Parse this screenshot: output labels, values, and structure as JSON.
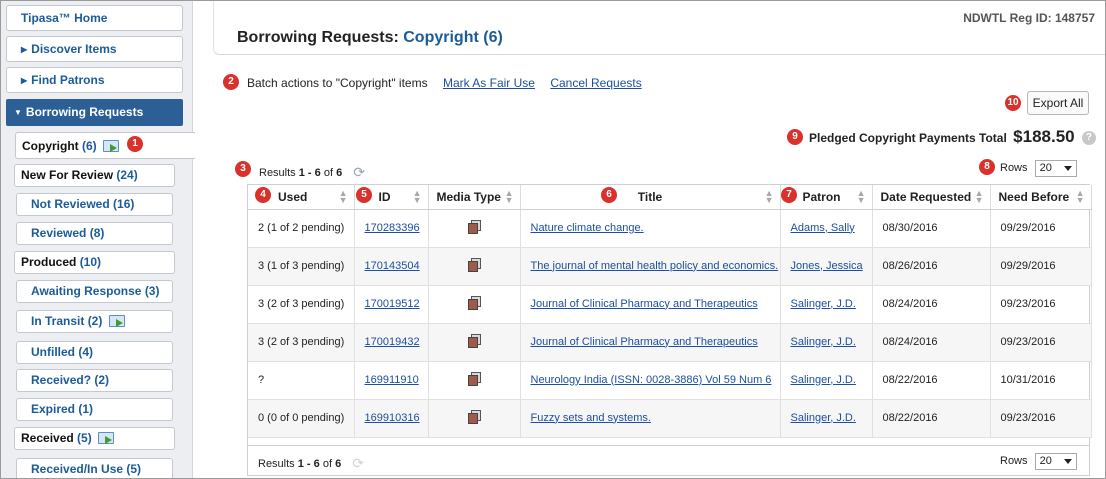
{
  "sidebar": {
    "home": "Tipasa™ Home",
    "discover": "Discover Items",
    "find_patrons": "Find Patrons",
    "section": "Borrowing Requests",
    "items": [
      {
        "label": "Copyright",
        "count": "(6)"
      },
      {
        "label": "New For Review",
        "count": "(24)"
      },
      {
        "label": "Not Reviewed",
        "count": "(16)"
      },
      {
        "label": "Reviewed",
        "count": "(8)"
      },
      {
        "label": "Produced",
        "count": "(10)"
      },
      {
        "label": "Awaiting Response",
        "count": "(3)"
      },
      {
        "label": "In Transit",
        "count": "(2)"
      },
      {
        "label": "Unfilled",
        "count": "(4)"
      },
      {
        "label": "Received?",
        "count": "(2)"
      },
      {
        "label": "Expired",
        "count": "(1)"
      },
      {
        "label": "Received",
        "count": "(5)"
      },
      {
        "label": "Received/In Use",
        "count": "(5)"
      }
    ]
  },
  "header": {
    "title": "Borrowing Requests:",
    "title_highlight": "Copyright (6)",
    "reg_id": "NDWTL Reg ID: 148757"
  },
  "batch": {
    "label": "Batch actions to \"Copyright\" items",
    "mark_fair_use": "Mark As Fair Use",
    "cancel_requests": "Cancel Requests"
  },
  "export_label": "Export All",
  "pledged": {
    "label": "Pledged Copyright Payments Total",
    "amount": "$188.50",
    "help": "?"
  },
  "results": {
    "prefix": "Results",
    "range": "1 - 6",
    "of": "of",
    "total": "6"
  },
  "rows": {
    "label": "Rows",
    "value": "20"
  },
  "callouts": [
    "1",
    "2",
    "3",
    "4",
    "5",
    "6",
    "7",
    "8",
    "9",
    "10"
  ],
  "table": {
    "headers": [
      "Used",
      "ID",
      "Media Type",
      "Title",
      "Patron",
      "Date Requested",
      "Need Before"
    ],
    "rows": [
      {
        "used": "2 (1 of 2 pending)",
        "id": "170283396",
        "title": "Nature climate change.",
        "patron": "Adams, Sally",
        "date": "08/30/2016",
        "need": "09/29/2016"
      },
      {
        "used": "3 (1 of 3 pending)",
        "id": "170143504",
        "title": "The journal of mental health policy and economics.",
        "patron": "Jones, Jessica",
        "date": "08/26/2016",
        "need": "09/29/2016"
      },
      {
        "used": "3 (2 of 3 pending)",
        "id": "170019512",
        "title": "Journal of Clinical Pharmacy and Therapeutics",
        "patron": "Salinger, J.D.",
        "date": "08/24/2016",
        "need": "09/23/2016"
      },
      {
        "used": "3 (2 of 3 pending)",
        "id": "170019432",
        "title": "Journal of Clinical Pharmacy and Therapeutics",
        "patron": "Salinger, J.D.",
        "date": "08/24/2016",
        "need": "09/23/2016"
      },
      {
        "used": "?",
        "id": "169911910",
        "title": "Neurology India (ISSN: 0028-3886) Vol 59 Num 6",
        "patron": "Salinger, J.D.",
        "date": "08/22/2016",
        "need": "10/31/2016"
      },
      {
        "used": "0 (0 of 0 pending)",
        "id": "169910316",
        "title": "Fuzzy sets and systems.",
        "patron": "Salinger, J.D.",
        "date": "08/22/2016",
        "need": "09/23/2016"
      }
    ]
  }
}
